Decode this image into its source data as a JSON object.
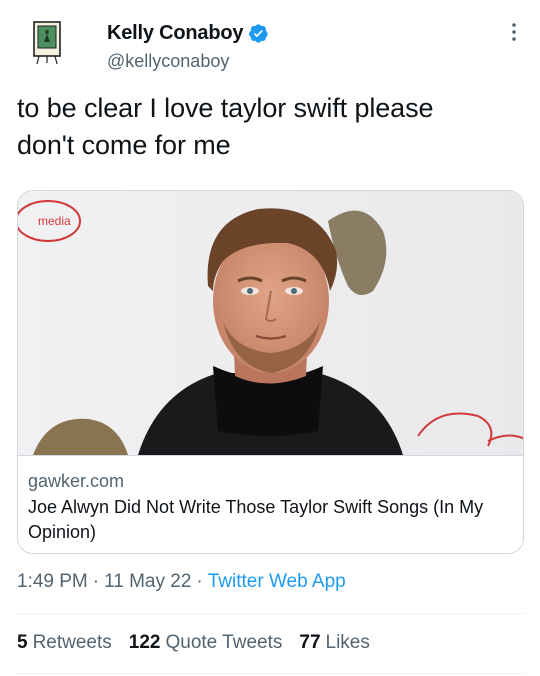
{
  "author": {
    "display_name": "Kelly Conaboy",
    "handle": "@kellyconaboy",
    "verified": true,
    "avatar_icon": "book-doodle-avatar"
  },
  "more_icon": "more-options-icon",
  "tweet": {
    "text_line1": "to be clear I love taylor swift please",
    "text_line2": "don't come for me"
  },
  "card": {
    "image_description_icon": "man-portrait-photo",
    "domain": "gawker.com",
    "title": "Joe Alwyn Did Not Write Those Taylor Swift Songs (In My Opinion)"
  },
  "meta": {
    "time": "1:49 PM",
    "separator": "·",
    "date": "11 May 22",
    "source": "Twitter Web App"
  },
  "stats": {
    "retweets_count": "5",
    "retweets_label": "Retweets",
    "quotes_count": "122",
    "quotes_label": "Quote Tweets",
    "likes_count": "77",
    "likes_label": "Likes"
  },
  "colors": {
    "text": "#0f1419",
    "secondary": "#536471",
    "link": "#1d9bf0",
    "border": "#cfd9de"
  }
}
